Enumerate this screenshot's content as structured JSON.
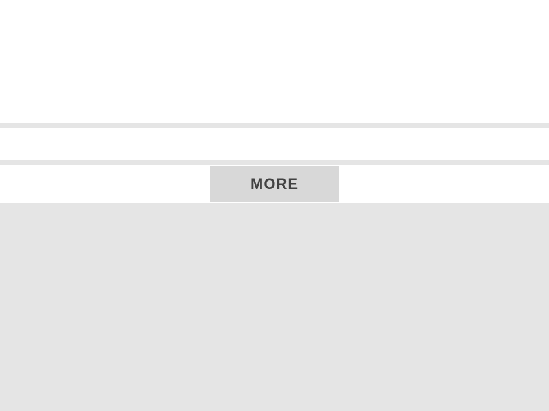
{
  "more": {
    "label": "MORE"
  }
}
